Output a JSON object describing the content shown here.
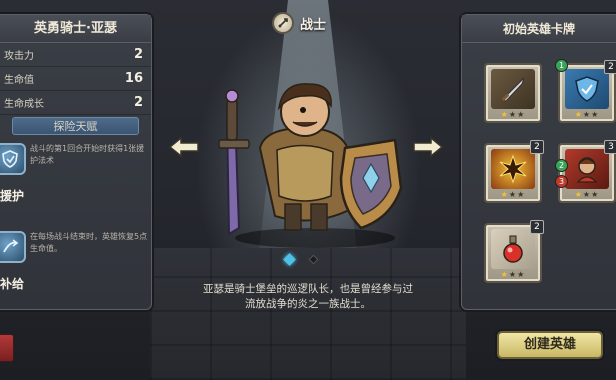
{
  "hero": {
    "name": "英勇骑士·亚瑟",
    "class_name": "战士",
    "description_line1": "亚瑟是骑士堡垒的巡逻队长，也是曾经参与过",
    "description_line2": "流放战争的炎之一族战士。"
  },
  "stats": [
    {
      "label": "攻击力",
      "value": "2"
    },
    {
      "label": "生命值",
      "value": "16"
    },
    {
      "label": "生命成长",
      "value": "2"
    }
  ],
  "talents": {
    "header": "探险天赋",
    "items": [
      {
        "name": "援护",
        "description": "战斗的第1回合开始时获得1张援护法术",
        "icon": "shield-hand-icon"
      },
      {
        "name": "补给",
        "description": "在每场战斗结束时，英雄恢复5点生命值。",
        "icon": "heal-icon"
      }
    ]
  },
  "cards": {
    "title": "初始英雄卡牌",
    "items": [
      {
        "icon": "sword-card-icon",
        "cost": "",
        "stars": 1
      },
      {
        "icon": "shield-card-icon",
        "cost": "2",
        "stars": 1,
        "badge": "1"
      },
      {
        "icon": "burst-card-icon",
        "cost": "2",
        "stars": 1
      },
      {
        "icon": "ally-card-icon",
        "cost": "3",
        "stars": 1,
        "attack": "2",
        "health": "3"
      },
      {
        "icon": "potion-card-icon",
        "cost": "2",
        "stars": 1
      }
    ]
  },
  "navigation": {
    "current_page": 1,
    "total_pages": 2
  },
  "buttons": {
    "create": "创建英雄"
  },
  "colors": {
    "accent_blue": "#4fc1e8",
    "button_gold": "#d9cb7f",
    "panel": "#363a41"
  }
}
